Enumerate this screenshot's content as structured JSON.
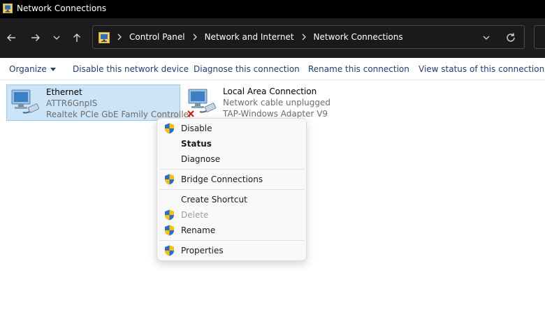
{
  "window": {
    "title": "Network Connections",
    "title_icon": "network-connections-icon"
  },
  "nav": {
    "back": "back-arrow-icon",
    "forward": "forward-arrow-icon",
    "recent": "chevron-down-icon",
    "up": "up-arrow-icon"
  },
  "address": {
    "crumbs": [
      "Control Panel",
      "Network and Internet",
      "Network Connections"
    ]
  },
  "toolbar": {
    "organize": "Organize",
    "disable_device": "Disable this network device",
    "diagnose": "Diagnose this connection",
    "rename": "Rename this connection",
    "view_status": "View status of this connection"
  },
  "adapters": [
    {
      "name": "Ethernet",
      "status": "ATTR6GnpIS",
      "device": "Realtek PCIe GbE Family Controller",
      "selected": true,
      "disconnected": false
    },
    {
      "name": "Local Area Connection",
      "status": "Network cable unplugged",
      "device": "TAP-Windows Adapter V9",
      "selected": false,
      "disconnected": true
    }
  ],
  "context_menu": {
    "disable": "Disable",
    "status": "Status",
    "diagnose": "Diagnose",
    "bridge": "Bridge Connections",
    "shortcut": "Create Shortcut",
    "delete": "Delete",
    "rename": "Rename",
    "properties": "Properties"
  },
  "colors": {
    "titlebar": "#000000",
    "navbar": "#1c1c1c",
    "command_text": "#1f3f6e",
    "selection": "#cce4f7",
    "menu_bg": "#f9f9f9"
  }
}
